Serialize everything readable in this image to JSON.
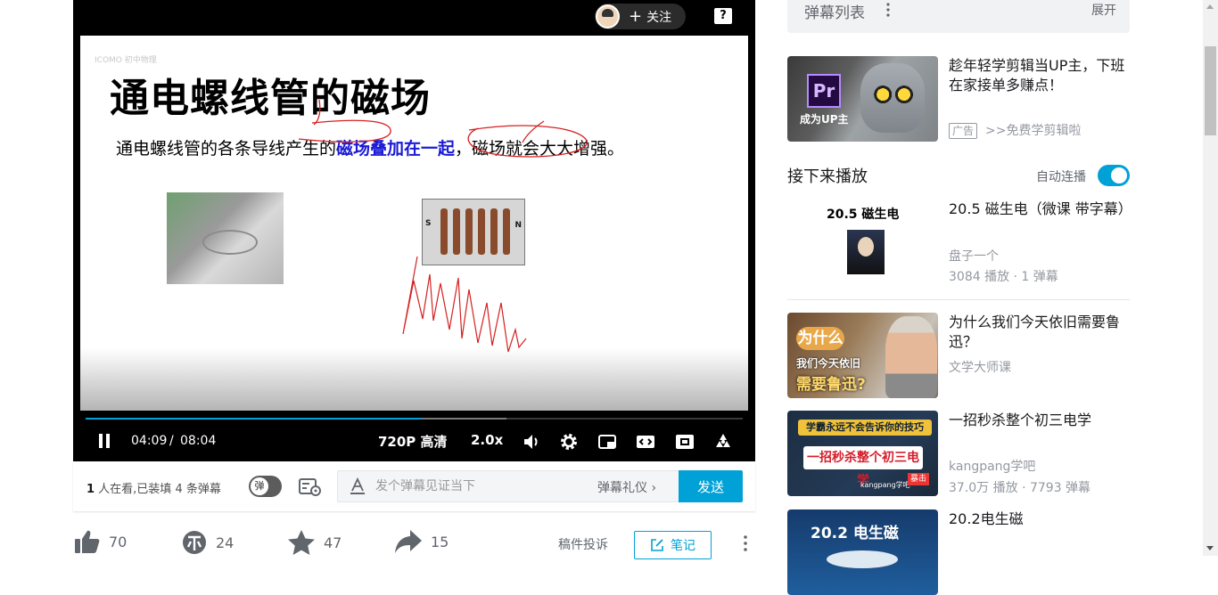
{
  "player": {
    "follow_label": "关注",
    "follow_plus": "+",
    "help_label": "?",
    "slide": {
      "watermark": "ICOMO 初中物理",
      "title": "通电螺线管的磁场",
      "line_pre": "通电螺线管的各条导线产生的",
      "line_highlight": "磁场叠加在一起",
      "line_post": "，磁场就会大大增强。",
      "pole_s": "S",
      "pole_n": "N"
    },
    "progress": {
      "played": 0.51,
      "buffered": 0.64
    },
    "time_current": "04:09",
    "time_separator": "/",
    "time_total": "08:04",
    "quality": "720P 高清",
    "speed": "2.0x",
    "accent_color": "#00a1d6"
  },
  "danmaku": {
    "viewers_count": "1",
    "viewers_text": " 人在看,已装填 4 条弹幕",
    "toggle_label": "弹",
    "input_placeholder": "发个弹幕见证当下",
    "etiquette": "弹幕礼仪 ›",
    "send": "发送"
  },
  "toolbar": {
    "like_count": "70",
    "coin_count": "24",
    "favorite_count": "47",
    "share_count": "15",
    "report": "稿件投诉",
    "note": "笔记"
  },
  "sidebar": {
    "danmaku_list": {
      "title": "弹幕列表",
      "expand": "展开"
    },
    "ad": {
      "title": "趁年轻学剪辑当UP主，下班在家接单多赚点！",
      "badge": "广告",
      "link": ">>免费学剪辑啦",
      "thumb_pr": "Pr",
      "thumb_text": "成为UP主"
    },
    "next": {
      "title": "接下来播放",
      "autoplay_label": "自动连播",
      "autoplay_on": true
    },
    "recommendations": [
      {
        "title": "20.5 磁生电（微课 带字幕）",
        "up": "盘子一个",
        "stats": "3084 播放 · 1 弹幕",
        "thumb_text": "20.5 磁生电"
      },
      {
        "title": "为什么我们今天依旧需要鲁迅？",
        "up": "文学大师课",
        "stats": "",
        "thumb_a": "为什么",
        "thumb_b": "我们今天依旧",
        "thumb_c": "需要鲁迅?"
      },
      {
        "title": "一招秒杀整个初三电学",
        "up": "kangpang学吧",
        "stats": "37.0万 播放 · 7793 弹幕",
        "thumb_a": "学霸永远不会告诉你的技巧",
        "thumb_b": "一招秒杀整个初三电学",
        "thumb_c": "kangpang学吧",
        "thumb_d": "暴击"
      },
      {
        "title": "20.2电生磁",
        "up": "",
        "stats": "",
        "thumb_text": "20.2 电生磁"
      }
    ]
  }
}
